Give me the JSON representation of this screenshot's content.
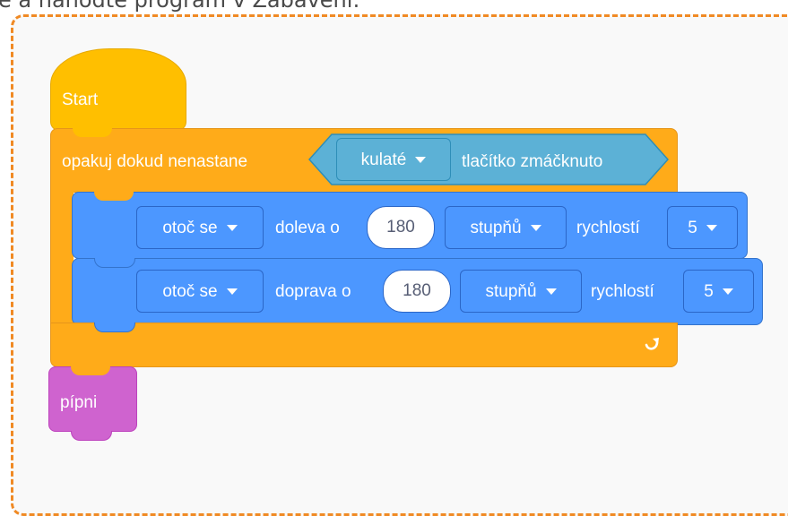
{
  "caption": "e a nahoďte program v Zabaveni:",
  "colors": {
    "event": "#ffbf00",
    "control": "#ffab19",
    "sensing": "#5cb1d6",
    "motion": "#4c97ff",
    "sound": "#cf63cf",
    "frame_border": "#f08a24"
  },
  "blocks": {
    "start": {
      "label": "Start"
    },
    "loop": {
      "label": "opakuj dokud nenastane",
      "icon": "repeat-arrow-icon",
      "condition": {
        "dropdown": "kulaté",
        "label": "tlačítko zmáčknuto"
      }
    },
    "turn_left": {
      "dropdown": "otoč se",
      "label": "doleva o",
      "amount": "180",
      "unit": "stupňů",
      "speed_label": "rychlostí",
      "speed": "5"
    },
    "turn_right": {
      "dropdown": "otoč se",
      "label": "doprava o",
      "amount": "180",
      "unit": "stupňů",
      "speed_label": "rychlostí",
      "speed": "5"
    },
    "beep": {
      "label": "pípni"
    }
  }
}
